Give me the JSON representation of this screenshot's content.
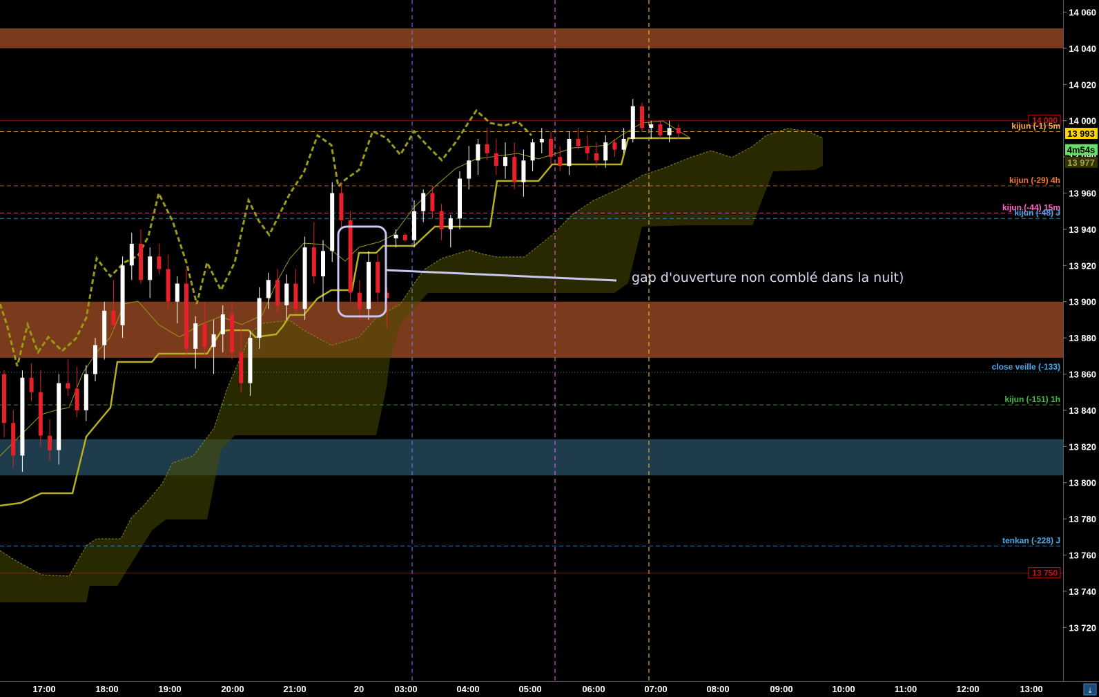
{
  "chart_data": {
    "type": "candlestick",
    "y_axis": {
      "range": [
        13700,
        14070
      ],
      "ticks": [
        13720,
        13740,
        13760,
        13780,
        13800,
        13820,
        13840,
        13860,
        13880,
        13900,
        13920,
        13940,
        13960,
        13980,
        14000,
        14020,
        14040,
        14060
      ],
      "tick_labels": [
        "13 720",
        "13 740",
        "13 760",
        "13 780",
        "13 800",
        "13 820",
        "13 840",
        "13 860",
        "13 880",
        "13 900",
        "13 920",
        "13 940",
        "13 960",
        "13 980",
        "14 000",
        "14 020",
        "14 040",
        "14 060"
      ]
    },
    "x_axis": {
      "tick_labels": [
        "17:00",
        "18:00",
        "19:00",
        "20:00",
        "21:00",
        "20",
        "03:00",
        "04:00",
        "05:00",
        "06:00",
        "07:00",
        "08:00",
        "09:00",
        "10:00",
        "11:00",
        "12:00",
        "13:00"
      ],
      "tick_colors": [
        "#ffffff",
        "#ffffff",
        "#ffffff",
        "#ffffff",
        "#ffffff",
        "#ffd400",
        "#ffffff",
        "#ffffff",
        "#ffffff",
        "#ffffff",
        "#ffffff",
        "#ffffff",
        "#ffffff",
        "#ffffff",
        "#ffffff",
        "#ffffff",
        "#ffffff"
      ]
    },
    "zones": [
      {
        "from": 14040,
        "to": 14051,
        "color": "#7a3a1c"
      },
      {
        "from": 13869,
        "to": 13900,
        "color": "#7a3a1c"
      },
      {
        "from": 13804,
        "to": 13824,
        "color": "#1e3c4c"
      }
    ],
    "levels": [
      {
        "price": 14000,
        "label": "14 000",
        "color": "#cc1111",
        "style": "solid",
        "boxed": true
      },
      {
        "price": 13994,
        "label": "kijun (-1) 5m",
        "color": "#ffb040",
        "style": "dashed",
        "boxed": false
      },
      {
        "price": 13964,
        "label": "kijun (-29) 4h",
        "color": "#f07830",
        "style": "dashed",
        "boxed": false
      },
      {
        "price": 13949,
        "label": "kijun (-44) 15m",
        "color": "#ff66cc",
        "style": "dashed",
        "boxed": false
      },
      {
        "price": 13946,
        "label": "kijun (-48) J",
        "color": "#44aaee",
        "style": "dashed",
        "boxed": false
      },
      {
        "price": 13861,
        "label": "close veille (-133)",
        "color": "#44aaee",
        "style": "dotted",
        "boxed": false
      },
      {
        "price": 13843,
        "label": "kijun (-151) 1h",
        "color": "#44bb44",
        "style": "dashed",
        "boxed": false
      },
      {
        "price": 13765,
        "label": "tenkan (-228) J",
        "color": "#44aaee",
        "style": "dashed",
        "boxed": false
      },
      {
        "price": 13750,
        "label": "13 750",
        "color": "#cc1111",
        "style": "solid",
        "boxed": true
      }
    ],
    "price_tags": [
      {
        "price": 13993,
        "label": "13 993",
        "bg": "#ffd400",
        "fg": "#000000"
      },
      {
        "price": 13984,
        "label": "4m54s",
        "bg": "#66dd66",
        "fg": "#000000"
      },
      {
        "price": 13977,
        "label": "13 977",
        "bg": "#333300",
        "fg": "#a8a040"
      }
    ],
    "candles": [
      [
        13860,
        13862,
        13825,
        13833
      ],
      [
        13833,
        13840,
        13808,
        13815
      ],
      [
        13815,
        13862,
        13806,
        13858
      ],
      [
        13858,
        13866,
        13845,
        13850
      ],
      [
        13850,
        13862,
        13820,
        13826
      ],
      [
        13826,
        13835,
        13812,
        13818
      ],
      [
        13818,
        13860,
        13810,
        13855
      ],
      [
        13855,
        13868,
        13848,
        13852
      ],
      [
        13852,
        13864,
        13836,
        13840
      ],
      [
        13840,
        13865,
        13834,
        13860
      ],
      [
        13860,
        13880,
        13856,
        13876
      ],
      [
        13876,
        13900,
        13868,
        13895
      ],
      [
        13895,
        13912,
        13884,
        13887
      ],
      [
        13887,
        13925,
        13880,
        13920
      ],
      [
        13920,
        13938,
        13912,
        13932
      ],
      [
        13932,
        13940,
        13910,
        13912
      ],
      [
        13912,
        13930,
        13902,
        13925
      ],
      [
        13925,
        13932,
        13915,
        13918
      ],
      [
        13918,
        13926,
        13896,
        13900
      ],
      [
        13900,
        13914,
        13888,
        13910
      ],
      [
        13910,
        13918,
        13870,
        13874
      ],
      [
        13874,
        13892,
        13863,
        13888
      ],
      [
        13888,
        13900,
        13870,
        13875
      ],
      [
        13875,
        13890,
        13860,
        13882
      ],
      [
        13882,
        13898,
        13872,
        13893
      ],
      [
        13893,
        13900,
        13868,
        13872
      ],
      [
        13872,
        13886,
        13850,
        13855
      ],
      [
        13855,
        13884,
        13848,
        13880
      ],
      [
        13880,
        13908,
        13874,
        13902
      ],
      [
        13902,
        13916,
        13896,
        13912
      ],
      [
        13912,
        13918,
        13894,
        13898
      ],
      [
        13898,
        13915,
        13890,
        13910
      ],
      [
        13910,
        13918,
        13893,
        13896
      ],
      [
        13896,
        13936,
        13890,
        13930
      ],
      [
        13930,
        13944,
        13910,
        13914
      ],
      [
        13914,
        13934,
        13900,
        13928
      ],
      [
        13928,
        13966,
        13922,
        13960
      ],
      [
        13960,
        13966,
        13940,
        13945
      ],
      [
        13945,
        13950,
        13900,
        13905
      ],
      [
        13905,
        13912,
        13890,
        13896
      ],
      [
        13896,
        13928,
        13890,
        13922
      ],
      [
        13922,
        13926,
        13900,
        13905
      ],
      [
        13905,
        13908,
        13885,
        13902
      ],
      [
        13935,
        13940,
        13930,
        13937
      ],
      [
        13937,
        13938,
        13933,
        13934
      ],
      [
        13934,
        13956,
        13930,
        13950
      ],
      [
        13950,
        13962,
        13944,
        13960
      ],
      [
        13960,
        13964,
        13946,
        13950
      ],
      [
        13950,
        13954,
        13934,
        13940
      ],
      [
        13940,
        13948,
        13930,
        13946
      ],
      [
        13946,
        13972,
        13940,
        13968
      ],
      [
        13968,
        13986,
        13962,
        13978
      ],
      [
        13978,
        13990,
        13970,
        13987
      ],
      [
        13987,
        13996,
        13978,
        13982
      ],
      [
        13982,
        13990,
        13970,
        13975
      ],
      [
        13975,
        13988,
        13968,
        13980
      ],
      [
        13980,
        13988,
        13962,
        13966
      ],
      [
        13966,
        13984,
        13958,
        13978
      ],
      [
        13978,
        13990,
        13972,
        13988
      ],
      [
        13988,
        13996,
        13982,
        13990
      ],
      [
        13990,
        13994,
        13976,
        13980
      ],
      [
        13980,
        13986,
        13972,
        13975
      ],
      [
        13975,
        13994,
        13970,
        13990
      ],
      [
        13990,
        13996,
        13984,
        13986
      ],
      [
        13986,
        13992,
        13978,
        13982
      ],
      [
        13982,
        13988,
        13974,
        13978
      ],
      [
        13978,
        13992,
        13974,
        13988
      ],
      [
        13988,
        13990,
        13980,
        13984
      ],
      [
        13984,
        13996,
        13982,
        13990
      ],
      [
        13990,
        14012,
        13988,
        14008
      ],
      [
        14008,
        14010,
        13994,
        13996
      ],
      [
        13996,
        14000,
        13990,
        13998
      ],
      [
        13998,
        14000,
        13990,
        13992
      ],
      [
        13992,
        14000,
        13988,
        13996
      ],
      [
        13996,
        13998,
        13990,
        13993
      ]
    ],
    "annotation": "gap d'ouverture non comblé dans la nuit)"
  }
}
